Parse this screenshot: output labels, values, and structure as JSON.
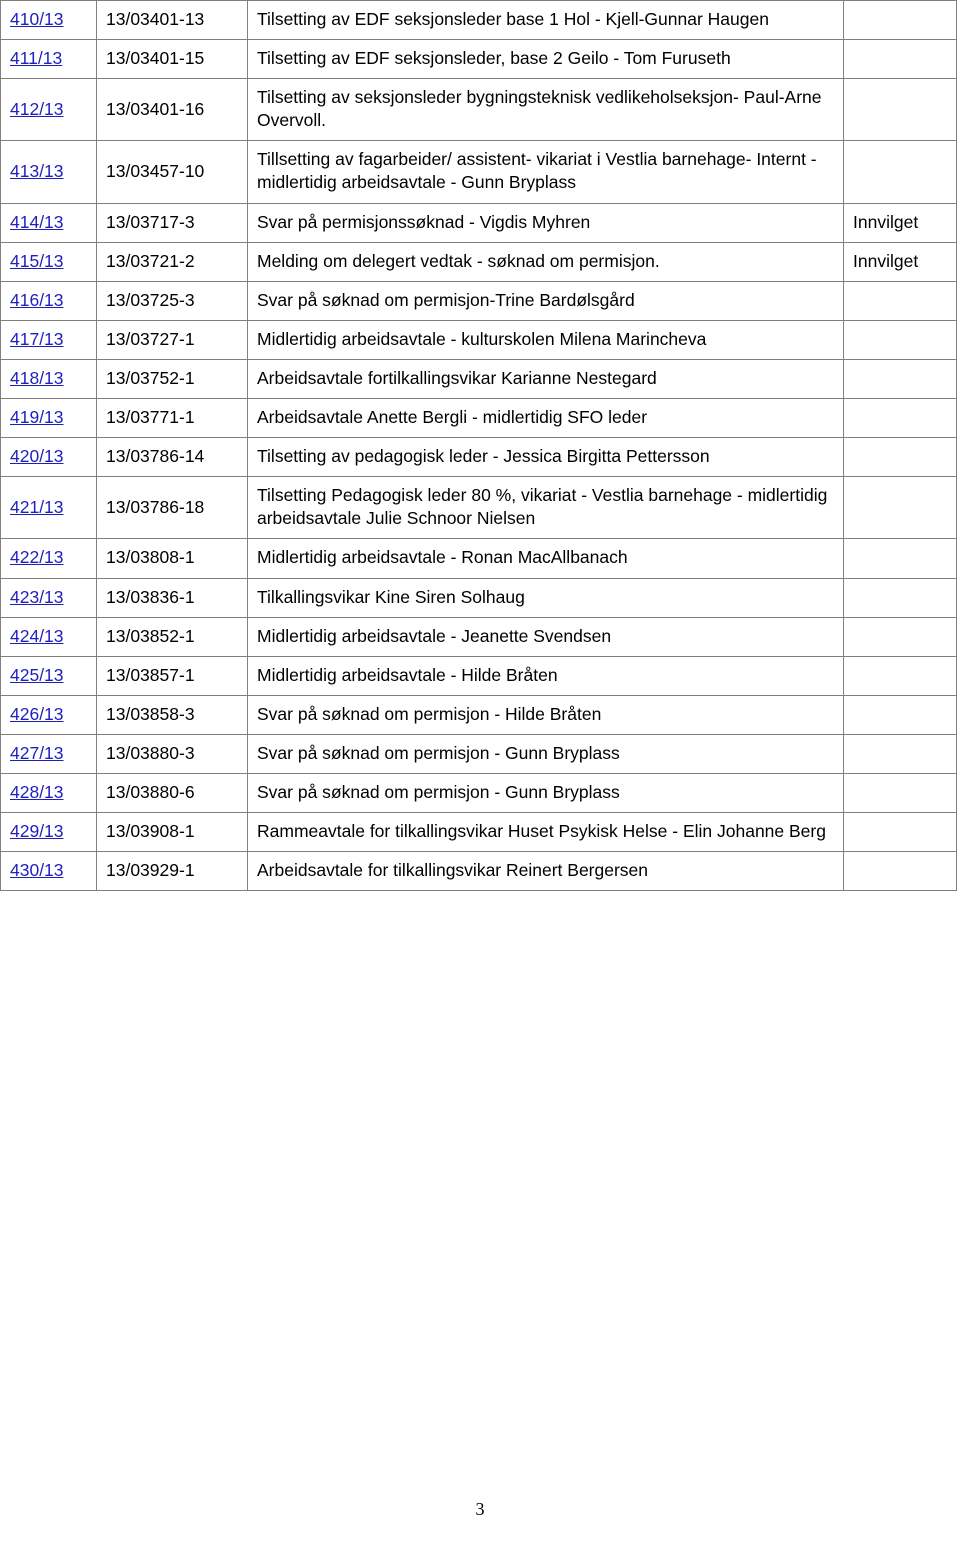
{
  "document": {
    "page_number": "3",
    "link_color": "#1F1FBE",
    "border_color": "#808080"
  },
  "table": {
    "columns": [
      "case_number",
      "reference",
      "title",
      "status"
    ],
    "rows": [
      {
        "case_number": "410/13",
        "reference": "13/03401-13",
        "title": "Tilsetting av EDF seksjonsleder base 1 Hol - Kjell-Gunnar Haugen",
        "status": ""
      },
      {
        "case_number": "411/13",
        "reference": "13/03401-15",
        "title": "Tilsetting av EDF seksjonsleder, base 2 Geilo - Tom Furuseth",
        "status": ""
      },
      {
        "case_number": "412/13",
        "reference": "13/03401-16",
        "title": "Tilsetting av seksjonsleder bygningsteknisk vedlikeholseksjon- Paul-Arne Overvoll.",
        "status": ""
      },
      {
        "case_number": "413/13",
        "reference": "13/03457-10",
        "title": "Tillsetting av fagarbeider/ assistent- vikariat i Vestlia barnehage- Internt - midlertidig arbeidsavtale - Gunn Bryplass",
        "status": ""
      },
      {
        "case_number": "414/13",
        "reference": "13/03717-3",
        "title": "Svar på permisjonssøknad - Vigdis Myhren",
        "status": "Innvilget"
      },
      {
        "case_number": "415/13",
        "reference": "13/03721-2",
        "title": "Melding om delegert vedtak - søknad om permisjon.",
        "status": "Innvilget"
      },
      {
        "case_number": "416/13",
        "reference": "13/03725-3",
        "title": "Svar på søknad om permisjon-Trine Bardølsgård",
        "status": ""
      },
      {
        "case_number": "417/13",
        "reference": "13/03727-1",
        "title": "Midlertidig arbeidsavtale - kulturskolen Milena Marincheva",
        "status": ""
      },
      {
        "case_number": "418/13",
        "reference": "13/03752-1",
        "title": "Arbeidsavtale fortilkallingsvikar Karianne Nestegard",
        "status": ""
      },
      {
        "case_number": "419/13",
        "reference": "13/03771-1",
        "title": "Arbeidsavtale  Anette Bergli - midlertidig SFO leder",
        "status": ""
      },
      {
        "case_number": "420/13",
        "reference": "13/03786-14",
        "title": "Tilsetting av pedagogisk leder - Jessica Birgitta Pettersson",
        "status": ""
      },
      {
        "case_number": "421/13",
        "reference": "13/03786-18",
        "title": "Tilsetting Pedagogisk leder 80 %, vikariat - Vestlia barnehage - midlertidig arbeidsavtale Julie Schnoor Nielsen",
        "status": ""
      },
      {
        "case_number": "422/13",
        "reference": "13/03808-1",
        "title": "Midlertidig arbeidsavtale - Ronan MacAllbanach",
        "status": ""
      },
      {
        "case_number": "423/13",
        "reference": "13/03836-1",
        "title": "Tilkallingsvikar Kine Siren Solhaug",
        "status": ""
      },
      {
        "case_number": "424/13",
        "reference": "13/03852-1",
        "title": "Midlertidig arbeidsavtale - Jeanette Svendsen",
        "status": ""
      },
      {
        "case_number": "425/13",
        "reference": "13/03857-1",
        "title": "Midlertidig arbeidsavtale - Hilde Bråten",
        "status": ""
      },
      {
        "case_number": "426/13",
        "reference": "13/03858-3",
        "title": "Svar på søknad om permisjon - Hilde Bråten",
        "status": ""
      },
      {
        "case_number": "427/13",
        "reference": "13/03880-3",
        "title": "Svar på søknad om permisjon -  Gunn Bryplass",
        "status": ""
      },
      {
        "case_number": "428/13",
        "reference": "13/03880-6",
        "title": "Svar på søknad om permisjon -   Gunn Bryplass",
        "status": ""
      },
      {
        "case_number": "429/13",
        "reference": "13/03908-1",
        "title": "Rammeavtale for tilkallingsvikar Huset Psykisk Helse - Elin Johanne Berg",
        "status": ""
      },
      {
        "case_number": "430/13",
        "reference": "13/03929-1",
        "title": "Arbeidsavtale for tilkallingsvikar  Reinert Bergersen",
        "status": ""
      }
    ]
  }
}
